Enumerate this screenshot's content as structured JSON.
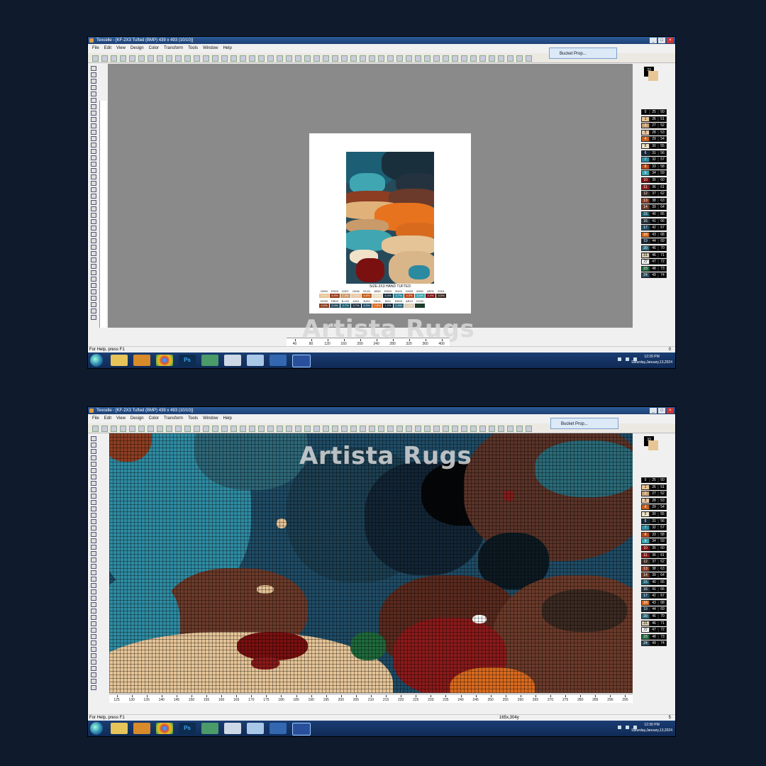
{
  "screen1": {
    "window_title": "Texcelle - [KF-2X3 Tufted (BMP) 439 x 493 (10/10)]",
    "menu": [
      "File",
      "Edit",
      "View",
      "Design",
      "Color",
      "Transform",
      "Tools",
      "Window",
      "Help"
    ],
    "bucket_label": "Bucket Prop...",
    "status_help": "For Help, press F1",
    "status_right": "0",
    "size_caption": "SIZE-2X3 HAND TUFTED",
    "hruler_labels": [
      "40",
      "80",
      "120",
      "160",
      "200",
      "240",
      "280",
      "320",
      "360",
      "400"
    ],
    "legend_row1": [
      {
        "code": "D009",
        "pct": "3.1%",
        "color": "#e5c497"
      },
      {
        "code": "ED03",
        "pct": "6.9%",
        "color": "#9a3c1c"
      },
      {
        "code": "D307",
        "pct": "7.3%",
        "color": "#c99a6a"
      },
      {
        "code": "D006",
        "pct": "2.1%",
        "color": "#e7c7a4"
      },
      {
        "code": "EL03",
        "pct": "6.8%",
        "color": "#c45e1a"
      },
      {
        "code": "A052",
        "pct": "4.2%",
        "color": "#e9dcc3"
      },
      {
        "code": "ED03",
        "pct": "6.4%",
        "color": "#1a2f3c"
      },
      {
        "code": "B103",
        "pct": "4.7%",
        "color": "#2c8aa0"
      },
      {
        "code": "DH03",
        "pct": "4.3%",
        "color": "#b5451a"
      },
      {
        "code": "B100",
        "pct": "4.4%",
        "color": "#3fa6b2"
      },
      {
        "code": "AP01",
        "pct": "2.4%",
        "color": "#7a1010"
      },
      {
        "code": "EJ01",
        "pct": "3.0%",
        "color": "#3b2a22"
      }
    ],
    "legend_row2": [
      {
        "code": "DG02",
        "pct": "4.0%",
        "color": "#8c3d22"
      },
      {
        "code": "EB03",
        "pct": "2.4%",
        "color": "#2a4a5a"
      },
      {
        "code": "B-102",
        "pct": "3.7%",
        "color": "#1e5e6e"
      },
      {
        "code": "AJ01",
        "pct": "3.7%",
        "color": "#24323f"
      },
      {
        "code": "BJ02",
        "pct": "6.5%",
        "color": "#1f4c66"
      },
      {
        "code": "DK01",
        "pct": "2.8%",
        "color": "#d86a1e"
      },
      {
        "code": "BI01",
        "pct": "1.2%",
        "color": "#142430"
      },
      {
        "code": "BD03",
        "pct": "1.4%",
        "color": "#2d6778"
      },
      {
        "code": "AR12",
        "pct": "1.1%",
        "color": "#d9cbb2"
      },
      {
        "code": "CC02",
        "pct": "",
        "color": "#1f3c2c"
      }
    ],
    "watermark": "Artista Rugs",
    "clock_time": "12:29 PM",
    "clock_date": "Saturday,January,13,2024"
  },
  "screen2": {
    "window_title": "Texcelle - [KF-2X3 Tufted (BMP) 439 x 493 (10/10)]",
    "menu": [
      "File",
      "Edit",
      "View",
      "Design",
      "Color",
      "Transform",
      "Tools",
      "Window",
      "Help"
    ],
    "bucket_label": "Bucket Prop...",
    "status_help": "For Help, press F1",
    "status_coords": "165x,304y",
    "status_right": "5",
    "hruler_labels": [
      "125",
      "130",
      "135",
      "140",
      "145",
      "150",
      "155",
      "160",
      "165",
      "170",
      "175",
      "180",
      "185",
      "190",
      "195",
      "200",
      "205",
      "210",
      "215",
      "220",
      "225",
      "230",
      "235",
      "240",
      "245",
      "250",
      "255",
      "260",
      "265",
      "270",
      "275",
      "280",
      "285",
      "290",
      "295"
    ],
    "watermark": "Artista Rugs",
    "clock_time": "12:30 PM",
    "clock_date": "Saturday,January,13,2024"
  },
  "palette": {
    "current_index": "33",
    "rows": [
      {
        "a": "0",
        "b": "25",
        "c": "50",
        "color": "#000000"
      },
      {
        "a": "1",
        "b": "26",
        "c": "51",
        "color": "#e8c595"
      },
      {
        "a": "2",
        "b": "27",
        "c": "52",
        "color": "#c8a07a"
      },
      {
        "a": "3",
        "b": "28",
        "c": "53",
        "color": "#e6c7a6"
      },
      {
        "a": "4",
        "b": "29",
        "c": "54",
        "color": "#c66020"
      },
      {
        "a": "5",
        "b": "30",
        "c": "55",
        "color": "#efe2c8"
      },
      {
        "a": "6",
        "b": "31",
        "c": "56",
        "color": "#132535"
      },
      {
        "a": "7",
        "b": "32",
        "c": "57",
        "color": "#2e8ba2"
      },
      {
        "a": "8",
        "b": "33",
        "c": "58",
        "color": "#b54a1c"
      },
      {
        "a": "9",
        "b": "34",
        "c": "59",
        "color": "#3ea5b1"
      },
      {
        "a": "10",
        "b": "35",
        "c": "60",
        "color": "#7a1010"
      },
      {
        "a": "11",
        "b": "36",
        "c": "61",
        "color": "#8a1a1a"
      },
      {
        "a": "12",
        "b": "37",
        "c": "62",
        "color": "#3b2a22"
      },
      {
        "a": "13",
        "b": "38",
        "c": "63",
        "color": "#8c3d22"
      },
      {
        "a": "14",
        "b": "39",
        "c": "64",
        "color": "#6b3a2a"
      },
      {
        "a": "15",
        "b": "40",
        "c": "65",
        "color": "#1e5e6e"
      },
      {
        "a": "16",
        "b": "41",
        "c": "66",
        "color": "#24323f"
      },
      {
        "a": "17",
        "b": "42",
        "c": "67",
        "color": "#1f4c66"
      },
      {
        "a": "18",
        "b": "43",
        "c": "68",
        "color": "#d86a1e"
      },
      {
        "a": "19",
        "b": "44",
        "c": "69",
        "color": "#142430"
      },
      {
        "a": "20",
        "b": "45",
        "c": "70",
        "color": "#2d6778"
      },
      {
        "a": "21",
        "b": "46",
        "c": "71",
        "color": "#d9cbb2"
      },
      {
        "a": "22",
        "b": "47",
        "c": "72",
        "color": "#ffffff"
      },
      {
        "a": "23",
        "b": "48",
        "c": "73",
        "color": "#1f6a3c"
      },
      {
        "a": "24",
        "b": "49",
        "c": "74",
        "color": "#2a4a5a"
      }
    ]
  },
  "colors": {
    "background": "#0f1b2c",
    "canvas_gray": "#8a8a8a",
    "taskbar": "#163566",
    "accent_blue": "#2c5c9a"
  },
  "icons": [
    "windows-start-icon",
    "explorer-icon",
    "media-player-icon",
    "chrome-icon",
    "photoshop-icon",
    "picture-icon",
    "paint-icon",
    "notepad-icon",
    "shield-icon",
    "texcelle-icon"
  ]
}
